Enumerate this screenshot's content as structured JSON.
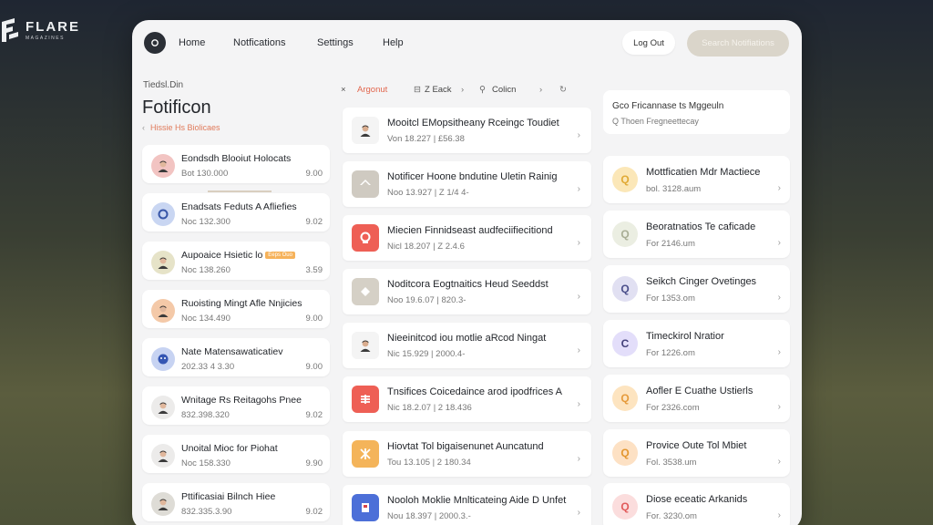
{
  "brand": {
    "name": "FLARE",
    "sub": "MAGAZINES"
  },
  "nav": {
    "home": "Home",
    "notifications": "Notfications",
    "settings": "Settings",
    "help": "Help"
  },
  "actions": {
    "logout": "Log Out",
    "search": "Search Notifiations"
  },
  "left": {
    "crumb": "Tiedsl.Din",
    "title": "Fotificon",
    "back_label": "Hissie Hs Biolicaes",
    "items": [
      {
        "title": "Eondsdh Blooiut Holocats",
        "sub": "Bot 130.000",
        "value": "9.00",
        "avatar": "person",
        "color": "#f2c4c2"
      },
      {
        "title": "Enadsats Feduts A Afliefies",
        "sub": "Noc 132.300",
        "value": "9.02",
        "avatar": "ring",
        "color": "#c9d6f2"
      },
      {
        "title": "Aupoaice Hsietic lo",
        "tag": "Eeps Ouo",
        "sub": "Noc 138.260",
        "value": "3.59",
        "avatar": "person",
        "color": "#e6e3c8"
      },
      {
        "title": "Ruoisting Mingt Afle Nnjicies",
        "sub": "Noc 134.490",
        "value": "9.00",
        "avatar": "person",
        "color": "#f4c9a8"
      },
      {
        "title": "Nate Matensawaticatiev",
        "sub": "202.33 4 3.30",
        "value": "9.00",
        "avatar": "face",
        "color": "#c7d3f2"
      },
      {
        "title": "Wnitage Rs Reitagohs Pnee",
        "sub": "832.398.320",
        "value": "9.02",
        "avatar": "person",
        "color": "#ecebea"
      },
      {
        "title": "Unoital Mioc for Piohat",
        "sub": "Noc 158.330",
        "value": "9.90",
        "avatar": "person",
        "color": "#ecebea"
      },
      {
        "title": "Pttificasiai Bilnch Hiee",
        "sub": "832.335.3.90",
        "value": "9.02",
        "avatar": "person",
        "color": "#dedcd6"
      }
    ]
  },
  "filters": {
    "a": "Argonut",
    "b": "Z Eack",
    "c": "Colicn"
  },
  "middle": {
    "items": [
      {
        "title": "Mooitcl EMopsitheany Rceingc Toudiet",
        "sub": "Von 18.227   |   £56.38",
        "icon": "person",
        "color": "#f4f4f4"
      },
      {
        "title": "Notificer Hoone bndutine Uletin Rainig",
        "sub": "Noo 13.927   |   Z 1/4 4-",
        "icon": "home",
        "color": "#cfcac1"
      },
      {
        "title": "Miecien Finnidseast audfeciifiecitiond",
        "sub": "Nicl 18.207   |   Z 2.4.6",
        "icon": "ring",
        "color": "#ee5f55"
      },
      {
        "title": "Noditcora Eogtnaitics Heud Seeddst",
        "sub": "Noo 19.6.07   |   820.3-",
        "icon": "tile",
        "color": "#d5d0c6"
      },
      {
        "title": "Nieeinitcod iou motlie aRcod Ningat",
        "sub": "Nic 15.929   |   2000.4-",
        "icon": "person",
        "color": "#f4f4f4"
      },
      {
        "title": "Tnsifices Coicedaince arod ipodfrices A",
        "sub": "Nic 18.2.07   |   2 18.436",
        "icon": "grid",
        "color": "#ee5f55"
      },
      {
        "title": "Hiovtat Tol bigaisenunet Auncatund",
        "sub": "Tou 13.105   |   2 180.34",
        "icon": "star",
        "color": "#f4b45a"
      },
      {
        "title": "Nooloh Moklie Mnlticateing Aide D Unfet",
        "sub": "Nou 18.397   |   2000.3.-",
        "icon": "doc",
        "color": "#4c6fd8"
      }
    ]
  },
  "right": {
    "head_title": "Gco Fricannase ts Mggeuln",
    "head_sub": "Q Thoen Fregneettecay",
    "items": [
      {
        "title": "Mottficatien Mdr Mactiece",
        "sub": "bol. 3128.aum",
        "icon": "Q",
        "bg": "#fbe7b8",
        "fg": "#e0a935"
      },
      {
        "title": "Beoratnatios Te caficade",
        "sub": "For 2146.um",
        "icon": "Q",
        "bg": "#ebeee2",
        "fg": "#a8ad94"
      },
      {
        "title": "Seikch Cinger Ovetinges",
        "sub": "For 1353.om",
        "icon": "Q",
        "bg": "#e1e0f2",
        "fg": "#4b4f8a"
      },
      {
        "title": "Timeckirol Nratior",
        "sub": "For 1226.om",
        "icon": "C",
        "bg": "#e3defa",
        "fg": "#43407a"
      },
      {
        "title": "Aofler E Cuathe Ustierls",
        "sub": "For 2326.com",
        "icon": "Q",
        "bg": "#fde4c0",
        "fg": "#e59a3a"
      },
      {
        "title": "Provice Oute Tol Mbiet",
        "sub": "Fol. 3538.um",
        "icon": "Q",
        "bg": "#fde1c4",
        "fg": "#e3962e"
      },
      {
        "title": "Diose eceatic Arkanids",
        "sub": "For. 3230.om",
        "icon": "Q",
        "bg": "#fbdddd",
        "fg": "#e15a5a"
      }
    ]
  }
}
